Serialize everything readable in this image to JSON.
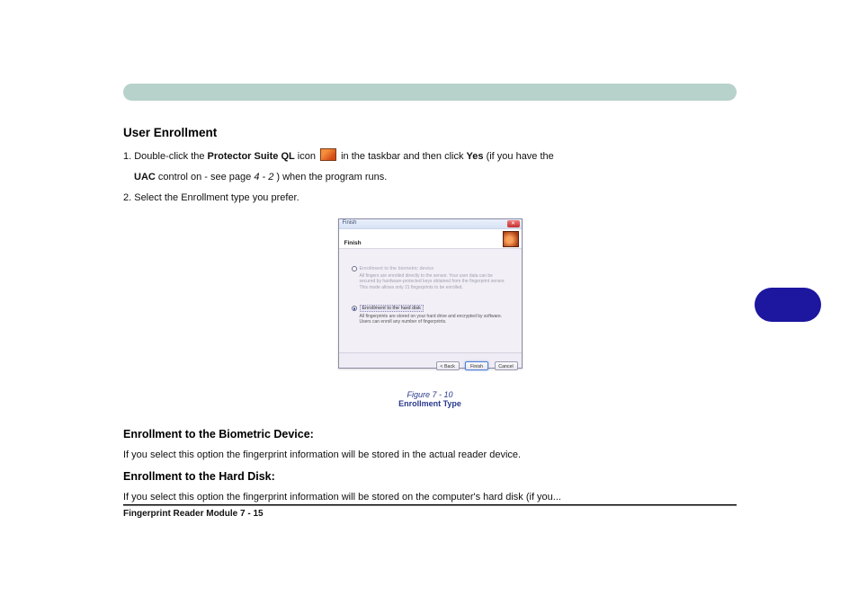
{
  "heading": "User Enrollment",
  "para1_prefix": "1. Double-click the ",
  "para1_bold": "Protector Suite QL",
  "para1_mid": " icon ",
  "para1_after": " in the taskbar and then click ",
  "para1_yes": "Yes",
  "para1_tail": " (if you have the",
  "para2_prefix": "",
  "para2_bold": "UAC",
  "para2_after": " control on - see page ",
  "para2_pgref": "4 - 2",
  "para2_tail": ") when the program runs.",
  "para3": "2. Select the Enrollment type you prefer.",
  "dialog": {
    "windowTitle": "Finish",
    "title": "Finish",
    "opt1": {
      "label": "Enrollment to the biometric device",
      "desc": "All fingers are enrolled directly to the sensor. Your user data can be secured by hardware-protected keys obtained from the fingerprint sensor. This mode allows only 21 fingerprints to be enrolled."
    },
    "opt2": {
      "label": "Enrollment to the hard disk",
      "desc": "All fingerprints are stored on your hard drive and encrypted by software. Users can enroll any number of fingerprints."
    },
    "buttons": {
      "back": "< Back",
      "finish": "Finish",
      "cancel": "Cancel"
    }
  },
  "figureCaption": "Figure 7 - 10",
  "figureCaption2": "Enrollment Type",
  "sub1": "Enrollment to the Biometric Device:",
  "sub1desc": "If you select this option the fingerprint information will be stored in the actual reader device.",
  "sub2": "Enrollment to the Hard Disk:",
  "sub2desc": "If you select this option the fingerprint information will be stored on the computer's hard disk (if you...",
  "footer": "Fingerprint Reader Module 7 - 15"
}
